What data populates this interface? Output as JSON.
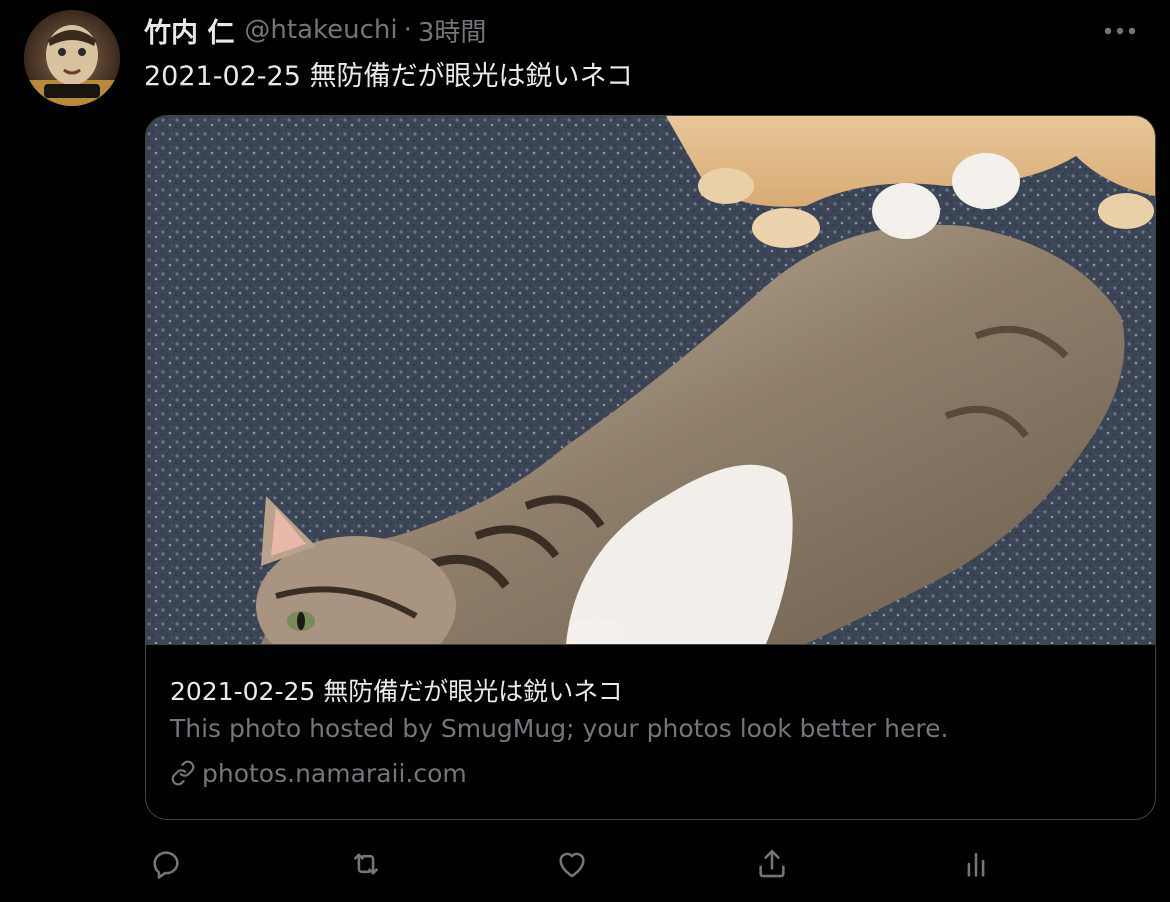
{
  "tweet": {
    "author": {
      "display_name": "竹内 仁",
      "handle": "@htakeuchi",
      "separator": "·",
      "timestamp": "3時間",
      "avatar_icon": "user-avatar"
    },
    "text": "2021-02-25 無防備だが眼光は鋭いネコ",
    "more_icon": "more-horizontal-icon"
  },
  "card": {
    "image_icon": "cat-photo",
    "title": "2021-02-25 無防備だが眼光は鋭いネコ",
    "description": "This photo hosted by SmugMug; your photos look better here.",
    "domain": "photos.namaraii.com",
    "domain_icon": "link-icon"
  },
  "actions": [
    {
      "icon": "reply-icon"
    },
    {
      "icon": "retweet-icon"
    },
    {
      "icon": "like-icon"
    },
    {
      "icon": "share-icon"
    },
    {
      "icon": "analytics-icon"
    }
  ],
  "colors": {
    "background": "#000000",
    "text_primary": "#e7e9ea",
    "text_secondary": "#71767b",
    "border": "#3e4144"
  }
}
